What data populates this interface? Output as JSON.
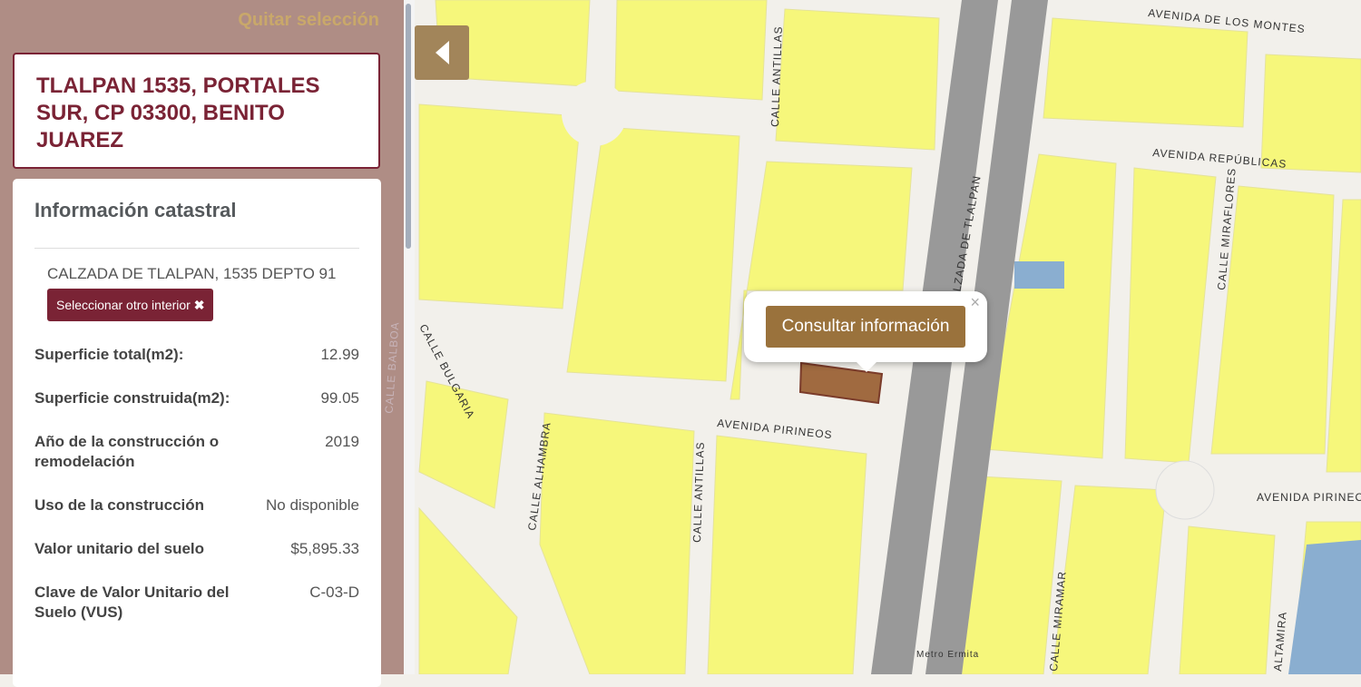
{
  "panel": {
    "quitar": "Quitar selección",
    "address": "TLALPAN 1535, PORTALES SUR, CP 03300, BENITO JUAREZ",
    "card_title": "Información catastral",
    "direccion": "CALZADA DE TLALPAN, 1535 DEPTO 91",
    "select_other": "Seleccionar otro interior",
    "rows": [
      {
        "k": "Superficie total(m2):",
        "v": "12.99"
      },
      {
        "k": "Superficie construida(m2):",
        "v": "99.05"
      },
      {
        "k": "Año de la construcción o remodelación",
        "v": "2019"
      },
      {
        "k": "Uso de la construcción",
        "v": "No disponible"
      },
      {
        "k": "Valor unitario del suelo",
        "v": "$5,895.33"
      },
      {
        "k": "Clave de Valor Unitario del Suelo (VUS)",
        "v": "C-03-D"
      }
    ]
  },
  "popup": {
    "button": "Consultar información",
    "close": "×"
  },
  "map": {
    "streets": {
      "montes": "AVENIDA DE LOS MONTES",
      "republicas": "AVENIDA REPÚBLICAS",
      "antillas": "CALLE ANTILLAS",
      "tlalpan": "CALZADA DE TLALPAN",
      "miraflores": "CALLE MIRAFLORES",
      "pirineos": "AVENIDA PIRINEOS",
      "pirineos2": "AVENIDA PIRINEO",
      "bulgaria": "CALLE BULGARIA",
      "alhambra": "CALLE ALHAMBRA",
      "miramar": "CALLE MIRAMAR",
      "altamira": "ALTAMIRA",
      "balboa": "CALLE BALBOA",
      "metro": "Metro Ermita"
    }
  }
}
